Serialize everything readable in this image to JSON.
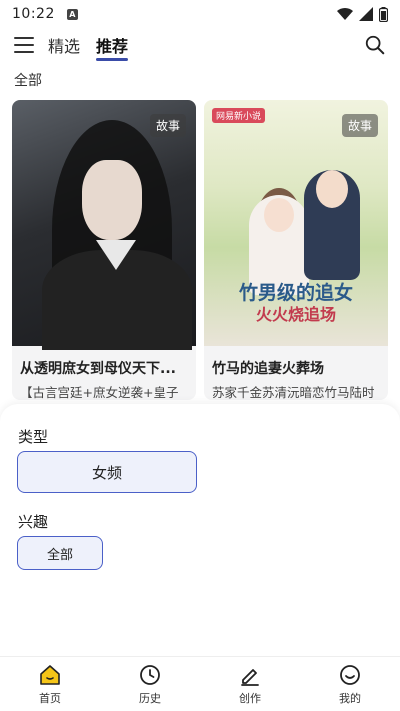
{
  "status_bar": {
    "time": "10:22",
    "notification_badge": "A"
  },
  "nav": {
    "tabs": [
      {
        "label": "精选",
        "active": false
      },
      {
        "label": "推荐",
        "active": true
      }
    ]
  },
  "section": {
    "label": "全部"
  },
  "cards": [
    {
      "badge": "故事",
      "title": "从透明庶女到母仪天下...",
      "desc": "【古言宫廷+庶女逆袭+皇子"
    },
    {
      "badge": "故事",
      "title": "竹马的追妻火葬场",
      "desc": "苏家千金苏清沅暗恋竹马陆时",
      "cover_tag": "网易新小说",
      "cover_title_1": "竹男级的追女",
      "cover_title_2": "火火烧追场"
    }
  ],
  "filter": {
    "type_label": "类型",
    "type_value": "女频",
    "interest_label": "兴趣",
    "interest_value": "全部"
  },
  "bottom_nav": {
    "items": [
      {
        "label": "首页",
        "icon": "home-icon",
        "active": true
      },
      {
        "label": "历史",
        "icon": "clock-icon",
        "active": false
      },
      {
        "label": "创作",
        "icon": "pen-icon",
        "active": false
      },
      {
        "label": "我的",
        "icon": "smile-icon",
        "active": false
      }
    ]
  },
  "colors": {
    "accent": "#3a4ca8",
    "chip_border": "#4b60c8",
    "chip_bg": "#eef1fb",
    "home_active": "#f5c518"
  }
}
